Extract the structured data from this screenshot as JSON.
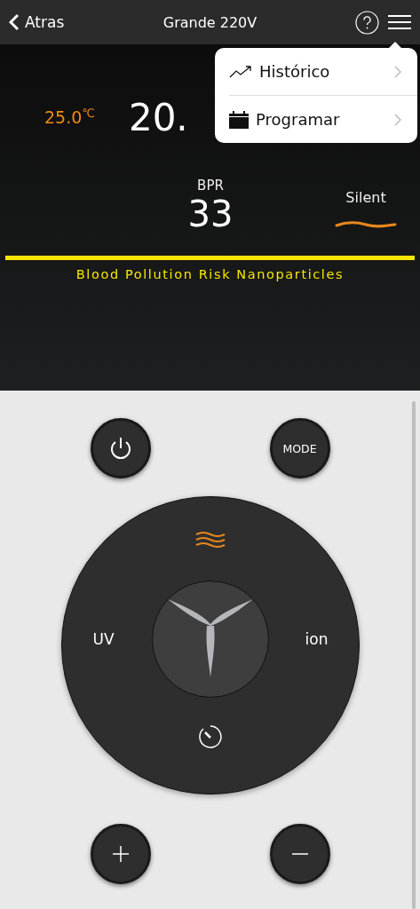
{
  "header": {
    "back_label": "Atras",
    "title": "Grande 220V"
  },
  "menu": {
    "open": true,
    "items": [
      {
        "kind": "history",
        "label": "Histórico"
      },
      {
        "kind": "schedule",
        "label": "Programar"
      }
    ]
  },
  "readings": {
    "temperature": "25.0",
    "temperature_unit": "℃",
    "value": "20.",
    "bpr_label": "BPR",
    "bpr_value": "33",
    "fan_mode": "Silent"
  },
  "risk": {
    "label": "Blood Pollution Risk Nanoparticles",
    "color": "#f5e600"
  },
  "controls": {
    "top": [
      {
        "kind": "power"
      },
      {
        "kind": "mode",
        "label": "MODE"
      }
    ],
    "dial": {
      "airflow_active": true,
      "left_label": "UV",
      "right_label": "ion"
    },
    "bottom": [
      {
        "kind": "plus"
      },
      {
        "kind": "minus"
      }
    ]
  }
}
